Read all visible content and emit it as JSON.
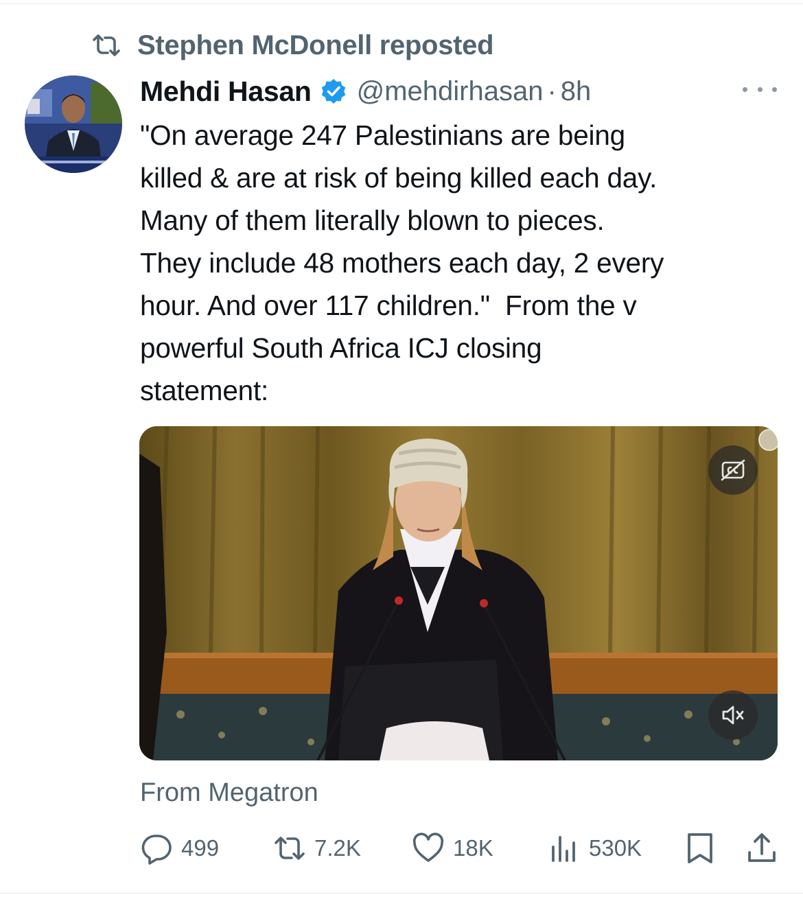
{
  "repost": {
    "label": "Stephen McDonell reposted"
  },
  "tweet": {
    "author_name": "Mehdi Hasan",
    "handle": "@mehdirhasan",
    "separator": "·",
    "time": "8h",
    "text": "\"On average 247 Palestinians are being\nkilled & are at risk of being killed each day.\nMany of them literally blown to pieces.\nThey include 48 mothers each day, 2 every\nhour. And over 117 children.\"  From the v\npowerful South Africa ICJ closing\nstatement:",
    "source": "From Megatron"
  },
  "actions": {
    "replies": "499",
    "reposts": "7.2K",
    "likes": "18K",
    "views": "530K"
  },
  "colors": {
    "text": "#0f1419",
    "secondary": "#536471",
    "verified": "#1d9bf0"
  },
  "icons": {
    "repost": "repost-icon",
    "verified": "verified-badge-icon",
    "more": "more-icon",
    "captions": "captions-off-icon",
    "mute": "muted-speaker-icon",
    "reply": "reply-icon",
    "like": "heart-icon",
    "views": "views-icon",
    "bookmark": "bookmark-icon",
    "share": "share-icon"
  }
}
